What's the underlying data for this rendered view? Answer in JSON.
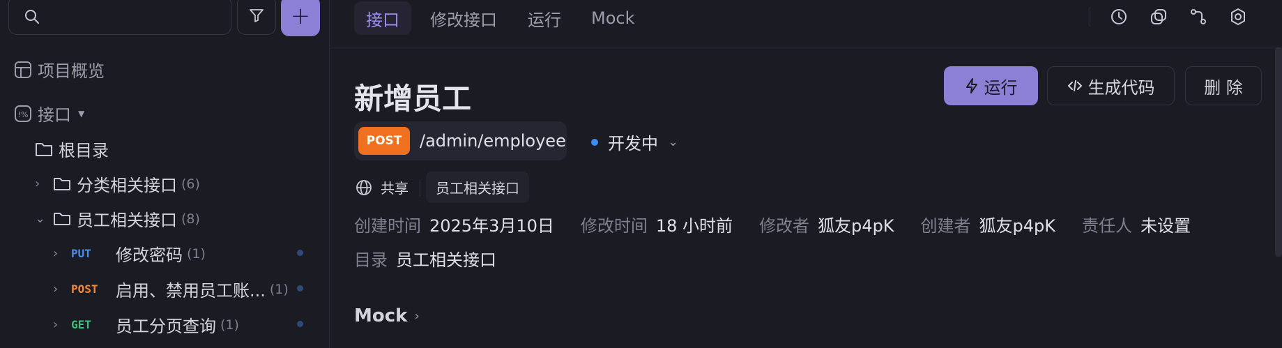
{
  "sidebar": {
    "search": {
      "placeholder": ""
    },
    "add_label": "+",
    "overview_label": "项目概览",
    "interfaces_label": "接口",
    "root_label": "根目录",
    "folders": [
      {
        "label": "分类相关接口",
        "count": "(6)",
        "chevron": "›"
      },
      {
        "label": "员工相关接口",
        "count": "(8)",
        "chevron": "⌄"
      }
    ],
    "endpoints": [
      {
        "method": "PUT",
        "label": "修改密码",
        "count": "(1)"
      },
      {
        "method": "POST",
        "label": "启用、禁用员工账...",
        "count": "(1)"
      },
      {
        "method": "GET",
        "label": "员工分页查询",
        "count": "(1)"
      }
    ]
  },
  "tabs": [
    "接口",
    "修改接口",
    "运行",
    "Mock"
  ],
  "main": {
    "title": "新增员工",
    "buttons": {
      "run": "运行",
      "generate_code": "生成代码",
      "delete": "删 除"
    },
    "method": "POST",
    "path": "/admin/employee",
    "status": "开发中",
    "share_label": "共享",
    "tag": "员工相关接口",
    "meta": {
      "created_label": "创建时间",
      "created_value": "2025年3月10日",
      "modified_label": "修改时间",
      "modified_value": "18 小时前",
      "modifier_label": "修改者",
      "modifier_value": "狐友p4pK",
      "creator_label": "创建者",
      "creator_value": "狐友p4pK",
      "owner_label": "责任人",
      "owner_value": "未设置",
      "dir_label": "目录",
      "dir_value": "员工相关接口"
    },
    "mock_section": "Mock"
  },
  "colors": {
    "accent": "#8b7fd6",
    "post": "#f07020",
    "put": "#4a90e2",
    "get": "#3fbf7f",
    "status_dot": "#3a8ef0"
  },
  "icons": [
    "search-icon",
    "filter-icon",
    "plus-icon",
    "overview-icon",
    "api-icon",
    "folder-icon",
    "globe-icon",
    "bolt-icon",
    "code-icon",
    "history-icon",
    "copy-icon",
    "branch-icon",
    "settings-icon"
  ]
}
